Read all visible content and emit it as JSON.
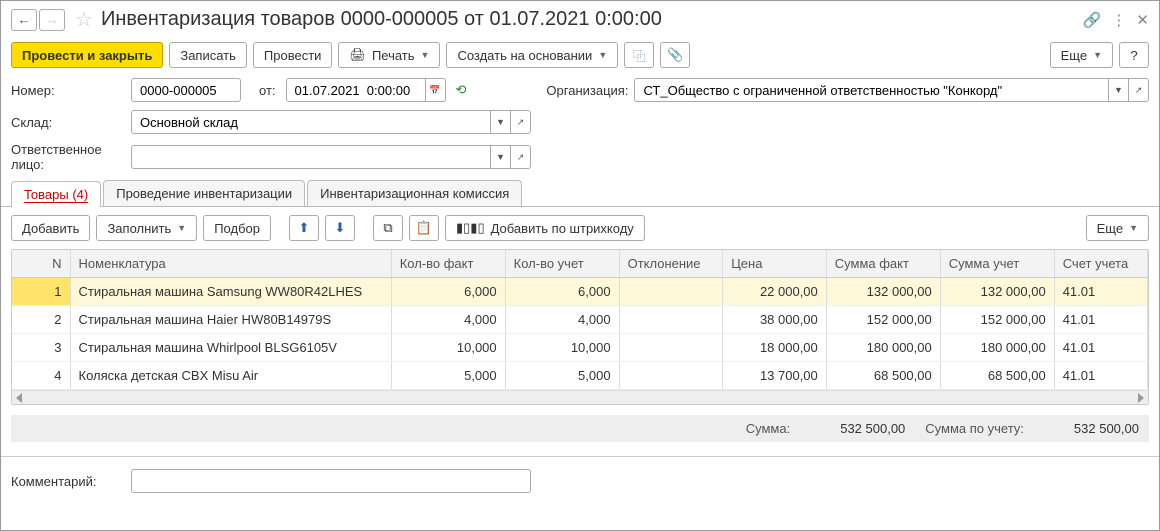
{
  "title": "Инвентаризация товаров 0000-000005 от 01.07.2021 0:00:00",
  "toolbar": {
    "post_close": "Провести и закрыть",
    "save": "Записать",
    "post": "Провести",
    "print": "Печать",
    "create_based": "Создать на основании",
    "more": "Еще"
  },
  "form": {
    "number_label": "Номер:",
    "number_value": "0000-000005",
    "from_label": "от:",
    "date_value": "01.07.2021  0:00:00",
    "org_label": "Организация:",
    "org_value": "СТ_Общество с ограниченной ответственностью \"Конкорд\"",
    "warehouse_label": "Склад:",
    "warehouse_value": "Основной склад",
    "responsible_label": "Ответственное лицо:",
    "responsible_value": ""
  },
  "tabs": {
    "goods": "Товары (4)",
    "posting": "Проведение инвентаризации",
    "commission": "Инвентаризационная комиссия"
  },
  "subtoolbar": {
    "add": "Добавить",
    "fill": "Заполнить",
    "select": "Подбор",
    "barcode": "Добавить по штрихкоду",
    "more": "Еще"
  },
  "table": {
    "headers": {
      "n": "N",
      "nomenclature": "Номенклатура",
      "qty_fact": "Кол-во факт",
      "qty_acc": "Кол-во учет",
      "deviation": "Отклонение",
      "price": "Цена",
      "sum_fact": "Сумма факт",
      "sum_acc": "Сумма учет",
      "account": "Счет учета"
    },
    "rows": [
      {
        "n": "1",
        "nomenclature": "Стиральная машина Samsung WW80R42LHES",
        "qty_fact": "6,000",
        "qty_acc": "6,000",
        "deviation": "",
        "price": "22 000,00",
        "sum_fact": "132 000,00",
        "sum_acc": "132 000,00",
        "account": "41.01"
      },
      {
        "n": "2",
        "nomenclature": "Стиральная машина Haier HW80B14979S",
        "qty_fact": "4,000",
        "qty_acc": "4,000",
        "deviation": "",
        "price": "38 000,00",
        "sum_fact": "152 000,00",
        "sum_acc": "152 000,00",
        "account": "41.01"
      },
      {
        "n": "3",
        "nomenclature": "Стиральная машина Whirlpool BLSG6105V",
        "qty_fact": "10,000",
        "qty_acc": "10,000",
        "deviation": "",
        "price": "18 000,00",
        "sum_fact": "180 000,00",
        "sum_acc": "180 000,00",
        "account": "41.01"
      },
      {
        "n": "4",
        "nomenclature": "Коляска детская CBX Misu Air",
        "qty_fact": "5,000",
        "qty_acc": "5,000",
        "deviation": "",
        "price": "13 700,00",
        "sum_fact": "68 500,00",
        "sum_acc": "68 500,00",
        "account": "41.01"
      }
    ]
  },
  "totals": {
    "sum_label": "Сумма:",
    "sum_value": "532 500,00",
    "sum_acc_label": "Сумма по учету:",
    "sum_acc_value": "532 500,00"
  },
  "footer": {
    "comment_label": "Комментарий:",
    "comment_value": ""
  }
}
